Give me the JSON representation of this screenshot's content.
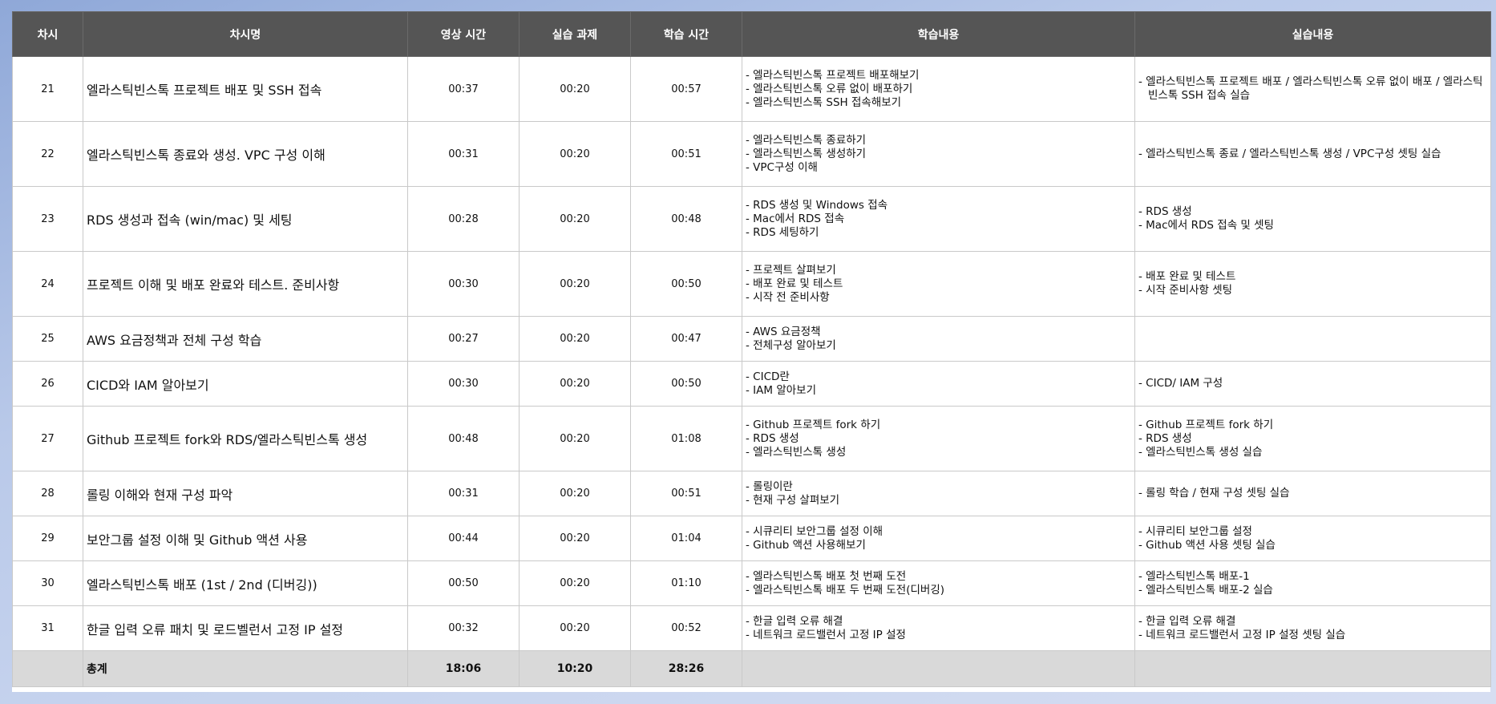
{
  "headers": {
    "no": "차시",
    "title": "차시명",
    "video": "영상 시간",
    "task": "실습 과제",
    "study": "학습 시간",
    "content": "학습내용",
    "practice": "실습내용"
  },
  "rows": [
    {
      "no": "21",
      "title": "엘라스틱빈스톡 프로젝트 배포 및 SSH 접속",
      "video": "00:37",
      "task": "00:20",
      "study": "00:57",
      "content": [
        "- 엘라스틱빈스톡 프로젝트 배포해보기",
        "- 엘라스틱빈스톡 오류 없이 배포하기",
        "- 엘라스틱빈스톡 SSH 접속해보기"
      ],
      "practice": [
        "- 엘라스틱빈스톡 프로젝트 배포 / 엘라스틱빈스톡 오류 없이 배포 / 엘라스틱빈스톡 SSH 접속 실습"
      ]
    },
    {
      "no": "22",
      "title": "엘라스틱빈스톡 종료와 생성. VPC 구성 이해",
      "video": "00:31",
      "task": "00:20",
      "study": "00:51",
      "content": [
        "- 엘라스틱빈스톡 종료하기",
        "- 엘라스틱빈스톡 생성하기",
        "- VPC구성 이해"
      ],
      "practice": [
        "- 엘라스틱빈스톡 종료 / 엘라스틱빈스톡 생성 / VPC구성 셋팅 실습"
      ]
    },
    {
      "no": "23",
      "title": "RDS 생성과 접속 (win/mac) 및 세팅",
      "video": "00:28",
      "task": "00:20",
      "study": "00:48",
      "content": [
        "- RDS 생성 및 Windows 접속",
        "- Mac에서 RDS 접속",
        "- RDS 세팅하기"
      ],
      "practice": [
        "- RDS 생성",
        "- Mac에서 RDS 접속 및 셋팅"
      ]
    },
    {
      "no": "24",
      "title": "프로젝트 이해 및 배포 완료와 테스트. 준비사항",
      "video": "00:30",
      "task": "00:20",
      "study": "00:50",
      "content": [
        "- 프로젝트 살펴보기",
        "- 배포 완료 및 테스트",
        "- 시작 전 준비사항"
      ],
      "practice": [
        "- 배포 완료 및 테스트",
        "- 시작 준비사항 셋팅"
      ]
    },
    {
      "no": "25",
      "title": "AWS 요금정책과 전체 구성 학습",
      "video": "00:27",
      "task": "00:20",
      "study": "00:47",
      "content": [
        "- AWS 요금정책",
        "- 전체구성 알아보기"
      ],
      "practice": []
    },
    {
      "no": "26",
      "title": "CICD와 IAM 알아보기",
      "video": "00:30",
      "task": "00:20",
      "study": "00:50",
      "content": [
        "- CICD란",
        "- IAM 알아보기"
      ],
      "practice": [
        "- CICD/ IAM 구성"
      ]
    },
    {
      "no": "27",
      "title": "Github 프로젝트 fork와 RDS/엘라스틱빈스톡 생성",
      "video": "00:48",
      "task": "00:20",
      "study": "01:08",
      "content": [
        "- Github 프로젝트 fork 하기",
        "- RDS 생성",
        "- 엘라스틱빈스톡 생성"
      ],
      "practice": [
        "- Github 프로젝트 fork 하기",
        "- RDS 생성",
        "- 엘라스틱빈스톡 생성 실습"
      ]
    },
    {
      "no": "28",
      "title": "롤링 이해와 현재 구성 파악",
      "video": "00:31",
      "task": "00:20",
      "study": "00:51",
      "content": [
        "- 롤링이란",
        "- 현재 구성 살펴보기"
      ],
      "practice": [
        "- 롤링 학습 / 현재 구성 셋팅 실습"
      ]
    },
    {
      "no": "29",
      "title": "보안그룹 설정 이해 및 Github 액션 사용",
      "video": "00:44",
      "task": "00:20",
      "study": "01:04",
      "content": [
        "- 시큐리티 보안그룹 설정 이해",
        "- Github 액션 사용해보기"
      ],
      "practice": [
        "- 시큐리티 보안그룹 설정",
        "- Github 액션 사용 셋팅 실습"
      ]
    },
    {
      "no": "30",
      "title": "엘라스틱빈스톡 배포 (1st / 2nd (디버깅))",
      "video": "00:50",
      "task": "00:20",
      "study": "01:10",
      "content": [
        "- 엘라스틱빈스톡 배포 첫 번째 도전",
        "- 엘라스틱빈스톡 배포 두 번째 도전(디버깅)"
      ],
      "practice": [
        "- 엘라스틱빈스톡 배포-1",
        "- 엘라스틱빈스톡 배포-2 실습"
      ]
    },
    {
      "no": "31",
      "title": "한글 입력 오류 패치 및 로드벨런서 고정 IP 설정",
      "video": "00:32",
      "task": "00:20",
      "study": "00:52",
      "content": [
        "- 한글 입력 오류 해결",
        "- 네트워크 로드밸런서 고정 IP 설정"
      ],
      "practice": [
        "- 한글 입력 오류 해결",
        "- 네트워크 로드밸런서 고정 IP 설정 셋팅 실습"
      ]
    }
  ],
  "total": {
    "label": "총계",
    "video": "18:06",
    "task": "10:20",
    "study": "28:26"
  },
  "colors": {
    "header_bg": "#555555",
    "total_bg": "#d9d9d9",
    "background": "#b9c9e9"
  }
}
